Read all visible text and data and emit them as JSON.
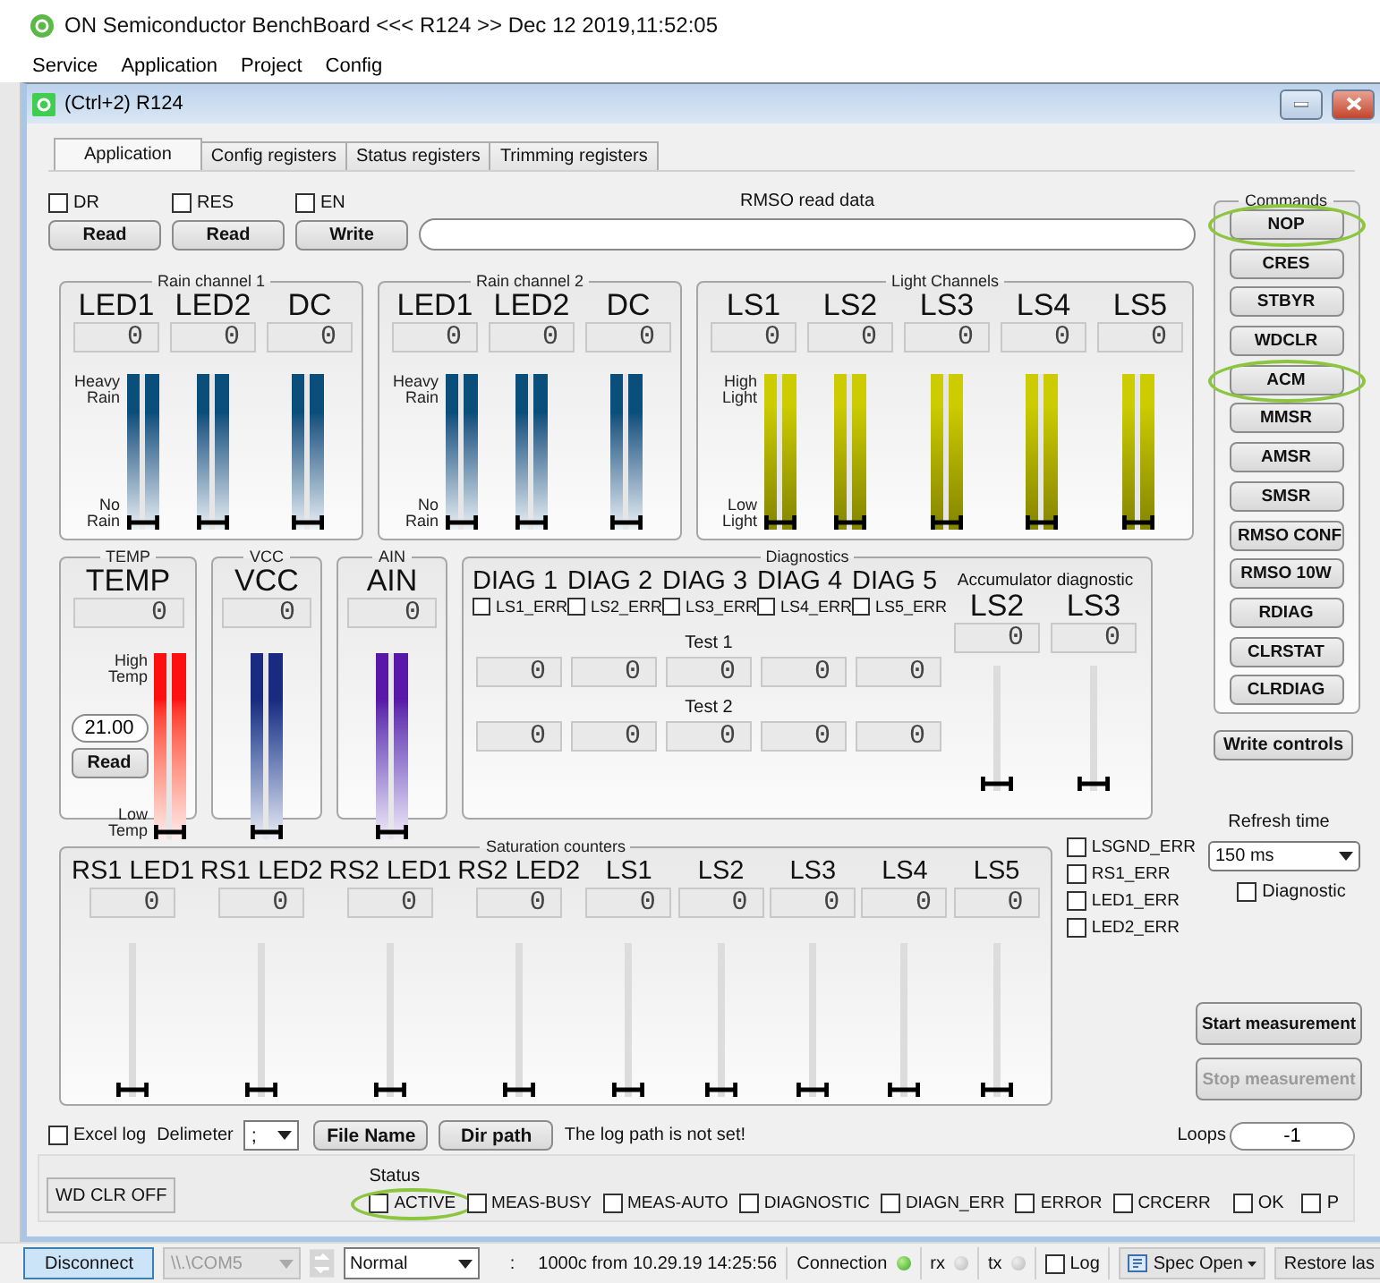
{
  "app": {
    "title": "ON Semiconductor BenchBoard <<< R124 >> Dec 12 2019,11:52:05"
  },
  "menu": [
    "Service",
    "Application",
    "Project",
    "Config"
  ],
  "window": {
    "title": "(Ctrl+2) R124"
  },
  "tabs": [
    {
      "label": "Application",
      "selected": true
    },
    {
      "label": "Config registers",
      "selected": false
    },
    {
      "label": "Status registers",
      "selected": false
    },
    {
      "label": "Trimming registers",
      "selected": false
    }
  ],
  "register_bits": [
    {
      "label": "DR",
      "checked": false,
      "button": "Read"
    },
    {
      "label": "RES",
      "checked": false,
      "button": "Read"
    },
    {
      "label": "EN",
      "checked": false,
      "button": "Write"
    }
  ],
  "rmso": {
    "label": "RMSO read data"
  },
  "meter_groups": [
    {
      "title": "Rain channel 1",
      "color": "#0a4f7c",
      "kind": "fade",
      "scale": {
        "top": "Heavy Rain",
        "bottom": "No Rain"
      },
      "channels": [
        {
          "name": "LED1",
          "reading": "0",
          "level": 0
        },
        {
          "name": "LED2",
          "reading": "0",
          "level": 0
        },
        {
          "name": "DC",
          "reading": "0",
          "level": 0
        }
      ]
    },
    {
      "title": "Rain channel 2",
      "color": "#0a4f7c",
      "kind": "fade",
      "scale": {
        "top": "Heavy Rain",
        "bottom": "No Rain"
      },
      "channels": [
        {
          "name": "LED1",
          "reading": "0",
          "level": 0
        },
        {
          "name": "LED2",
          "reading": "0",
          "level": 0
        },
        {
          "name": "DC",
          "reading": "0",
          "level": 0
        }
      ]
    },
    {
      "title": "Light Channels",
      "color": "#cccc00",
      "kind": "deepen",
      "scale": {
        "top": "High Light",
        "bottom": "Low Light"
      },
      "channels": [
        {
          "name": "LS1",
          "reading": "0",
          "level": 0
        },
        {
          "name": "LS2",
          "reading": "0",
          "level": 0
        },
        {
          "name": "LS3",
          "reading": "0",
          "level": 0
        },
        {
          "name": "LS4",
          "reading": "0",
          "level": 0
        },
        {
          "name": "LS5",
          "reading": "0",
          "level": 0
        }
      ]
    }
  ],
  "sensor_groups": [
    {
      "title": "TEMP",
      "color": "#ff1010",
      "kind": "fade",
      "scale": {
        "top": "High Temp",
        "bottom": "Low Temp"
      },
      "setpoint": {
        "value": "21.00",
        "button": "Read"
      },
      "channels": [
        {
          "name": "TEMP",
          "reading": "0",
          "level": 0
        }
      ]
    },
    {
      "title": "VCC",
      "color": "#1a2a80",
      "kind": "fade",
      "channels": [
        {
          "name": "VCC",
          "reading": "0",
          "level": 0
        }
      ]
    },
    {
      "title": "AIN",
      "color": "#5a18a8",
      "kind": "fade",
      "channels": [
        {
          "name": "AIN",
          "reading": "0",
          "level": 0
        }
      ]
    }
  ],
  "diagnostics": {
    "title": "Diagnostics",
    "columns": [
      {
        "name": "DIAG 1",
        "error_label": "LS1_ERR",
        "checked": false,
        "test_1": "0",
        "test_2": "0"
      },
      {
        "name": "DIAG 2",
        "error_label": "LS2_ERR",
        "checked": false,
        "test_1": "0",
        "test_2": "0"
      },
      {
        "name": "DIAG 3",
        "error_label": "LS3_ERR",
        "checked": false,
        "test_1": "0",
        "test_2": "0"
      },
      {
        "name": "DIAG 4",
        "error_label": "LS4_ERR",
        "checked": false,
        "test_1": "0",
        "test_2": "0"
      },
      {
        "name": "DIAG 5",
        "error_label": "LS5_ERR",
        "checked": false,
        "test_1": "0",
        "test_2": "0"
      }
    ],
    "test_labels": [
      "Test 1",
      "Test 2"
    ],
    "accumulator": {
      "title": "Accumulator diagnostic",
      "channels": [
        {
          "name": "LS2",
          "reading": "0",
          "level": 0
        },
        {
          "name": "LS3",
          "reading": "0",
          "level": 0
        }
      ]
    }
  },
  "saturation": {
    "title": "Saturation counters",
    "channels": [
      {
        "name": "RS1 LED1",
        "reading": "0",
        "level": 0
      },
      {
        "name": "RS1 LED2",
        "reading": "0",
        "level": 0
      },
      {
        "name": "RS2 LED1",
        "reading": "0",
        "level": 0
      },
      {
        "name": "RS2 LED2",
        "reading": "0",
        "level": 0
      },
      {
        "name": "LS1",
        "reading": "0",
        "level": 0
      },
      {
        "name": "LS2",
        "reading": "0",
        "level": 0
      },
      {
        "name": "LS3",
        "reading": "0",
        "level": 0
      },
      {
        "name": "LS4",
        "reading": "0",
        "level": 0
      },
      {
        "name": "LS5",
        "reading": "0",
        "level": 0
      }
    ]
  },
  "error_flags": [
    {
      "label": "LSGND_ERR",
      "checked": false
    },
    {
      "label": "RS1_ERR",
      "checked": false
    },
    {
      "label": "LED1_ERR",
      "checked": false
    },
    {
      "label": "LED2_ERR",
      "checked": false
    }
  ],
  "commands": {
    "title": "Commands",
    "buttons": [
      {
        "label": "NOP",
        "highlighted": true
      },
      {
        "label": "CRES",
        "highlighted": false
      },
      {
        "label": "STBYR",
        "highlighted": false
      },
      {
        "label": "WDCLR",
        "highlighted": false
      },
      {
        "label": "ACM",
        "highlighted": true
      },
      {
        "label": "MMSR",
        "highlighted": false
      },
      {
        "label": "AMSR",
        "highlighted": false
      },
      {
        "label": "SMSR",
        "highlighted": false
      },
      {
        "label": "RMSO CONF",
        "highlighted": false
      },
      {
        "label": "RMSO 10W",
        "highlighted": false
      },
      {
        "label": "RDIAG",
        "highlighted": false
      },
      {
        "label": "CLRSTAT",
        "highlighted": false
      },
      {
        "label": "CLRDIAG",
        "highlighted": false
      }
    ]
  },
  "write_controls": "Write controls",
  "refresh": {
    "label": "Refresh time",
    "value": "150 ms",
    "diagnostic": {
      "label": "Diagnostic",
      "checked": false
    }
  },
  "measurement": [
    {
      "label": "Start measurement",
      "disabled": false
    },
    {
      "label": "Stop measurement",
      "disabled": true
    }
  ],
  "log": {
    "excel": {
      "label": "Excel log",
      "checked": false
    },
    "delimiter_label": "Delimeter",
    "delimiter": ";",
    "buttons": [
      "File Name",
      "Dir path"
    ],
    "message": "The log path is not set!"
  },
  "loops": {
    "label": "Loops",
    "value": "-1"
  },
  "status": {
    "title": "Status",
    "wd_button": "WD CLR OFF",
    "flags": [
      {
        "label": "ACTIVE",
        "checked": false,
        "highlighted": true
      },
      {
        "label": "MEAS-BUSY",
        "checked": false,
        "highlighted": false
      },
      {
        "label": "MEAS-AUTO",
        "checked": false,
        "highlighted": false
      },
      {
        "label": "DIAGNOSTIC",
        "checked": false,
        "highlighted": false
      },
      {
        "label": "DIAGN_ERR",
        "checked": false,
        "highlighted": false
      },
      {
        "label": "ERROR",
        "checked": false,
        "highlighted": false
      },
      {
        "label": "CRCERR",
        "checked": false,
        "highlighted": false
      }
    ],
    "right_flags": [
      {
        "label": "OK",
        "checked": false
      },
      {
        "label": "P",
        "checked": false
      }
    ]
  },
  "status_bar": {
    "disconnect": "Disconnect",
    "port": "\\\\.\\COM5",
    "mode": "Normal",
    "separator": ":",
    "message": "1000c from 10.29.19 14:25:56",
    "indicators": [
      {
        "label": "Connection",
        "on": true
      },
      {
        "label": "rx",
        "on": false
      },
      {
        "label": "tx",
        "on": false
      }
    ],
    "log": {
      "label": "Log",
      "checked": false
    },
    "spec": "Spec Open",
    "restore": "Restore las"
  }
}
